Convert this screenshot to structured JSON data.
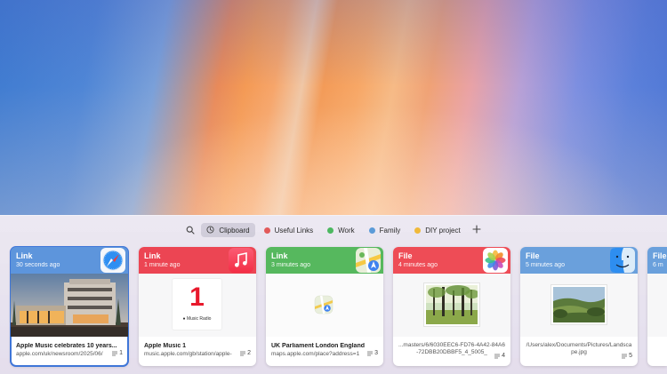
{
  "toolbar": {
    "search_icon": "magnifying-glass",
    "add_icon": "plus",
    "tabs": [
      {
        "label": "Clipboard",
        "icon": "clock",
        "active": true
      },
      {
        "label": "Useful Links",
        "color": "#e25a5a"
      },
      {
        "label": "Work",
        "color": "#4cb860"
      },
      {
        "label": "Family",
        "color": "#5b9bd8"
      },
      {
        "label": "DIY project",
        "color": "#f0b93a"
      }
    ]
  },
  "cards": [
    {
      "type": "Link",
      "time": "30 seconds ago",
      "title": "Apple Music celebrates 10 years...",
      "subtitle": "apple.com/uk/newsroom/2025/06/",
      "count": "1",
      "header_color": "#5d95dc",
      "app_icon": "safari",
      "selected": true
    },
    {
      "type": "Link",
      "time": "1 minute ago",
      "title": "Apple Music 1",
      "subtitle": "music.apple.com/gb/station/apple-",
      "count": "2",
      "header_color": "#ec4553",
      "app_icon": "music",
      "preview_big": "1",
      "preview_small": "Music Radio"
    },
    {
      "type": "Link",
      "time": "3 minutes ago",
      "title": "UK Parliament London England",
      "subtitle": "maps.apple.com/place?address=1",
      "count": "3",
      "header_color": "#56b85e",
      "app_icon": "maps"
    },
    {
      "type": "File",
      "time": "4 minutes ago",
      "filename": "...masters/6/6030EEC6-FD76-4A42-84A6-72DBB20DBBF5_4_5005_",
      "count": "4",
      "header_color": "#ee4c56",
      "app_icon": "photos"
    },
    {
      "type": "File",
      "time": "5 minutes ago",
      "filename": "/Users/alex/Documents/Pictures/Landscape.jpg",
      "count": "5",
      "header_color": "#6aa0dc",
      "app_icon": "finder"
    },
    {
      "type": "File",
      "time": "6 m",
      "header_color": "#6aa0dc"
    }
  ]
}
